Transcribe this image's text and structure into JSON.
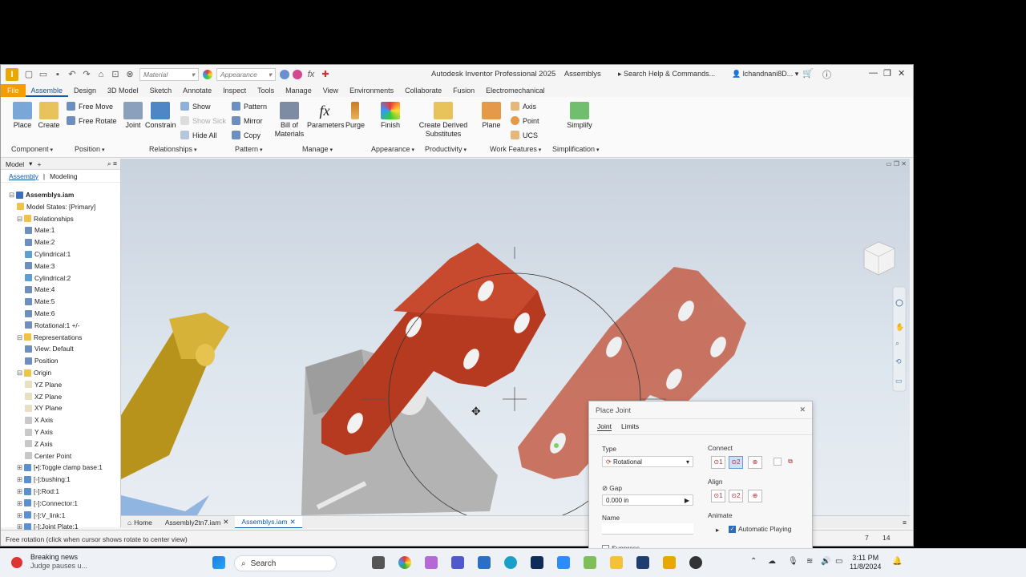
{
  "title_bar": {
    "app_title": "Autodesk Inventor Professional 2025",
    "project": "Assemblys",
    "material_placeholder": "Material",
    "appearance_placeholder": "Appearance",
    "search_placeholder": "Search Help & Commands...",
    "user": "lchandnani8D..."
  },
  "tabs": [
    "File",
    "Assemble",
    "Design",
    "3D Model",
    "Sketch",
    "Annotate",
    "Inspect",
    "Tools",
    "Manage",
    "View",
    "Environments",
    "Collaborate",
    "Fusion",
    "Electromechanical"
  ],
  "active_tab": "Assemble",
  "ribbon": {
    "place": "Place",
    "create": "Create",
    "free_move": "Free Move",
    "free_rotate": "Free Rotate",
    "joint": "Joint",
    "constrain": "Constrain",
    "show": "Show",
    "show_sick": "Show Sick",
    "hide_all": "Hide All",
    "pattern": "Pattern",
    "mirror": "Mirror",
    "copy": "Copy",
    "bill_of_materials_1": "Bill of",
    "bill_of_materials_2": "Materials",
    "parameters": "Parameters",
    "purge": "Purge",
    "finish": "Finish",
    "create_derived_1": "Create Derived",
    "create_derived_2": "Substitutes",
    "plane": "Plane",
    "axis": "Axis",
    "point": "Point",
    "ucs": "UCS",
    "simplify": "Simplify",
    "groups": {
      "component": "Component",
      "position": "Position",
      "relationships": "Relationships",
      "pattern": "Pattern",
      "manage": "Manage",
      "appearance": "Appearance",
      "productivity": "Productivity",
      "work_features": "Work Features",
      "simplification": "Simplification"
    }
  },
  "browser": {
    "header": "Model",
    "tab_assembly": "Assembly",
    "tab_modeling": "Modeling",
    "items": [
      {
        "label": "Assemblys.iam",
        "depth": 0
      },
      {
        "label": "Model States: [Primary]",
        "depth": 1
      },
      {
        "label": "Relationships",
        "depth": 1
      },
      {
        "label": "Mate:1",
        "depth": 2
      },
      {
        "label": "Mate:2",
        "depth": 2
      },
      {
        "label": "Cylindrical:1",
        "depth": 2
      },
      {
        "label": "Mate:3",
        "depth": 2
      },
      {
        "label": "Cylindrical:2",
        "depth": 2
      },
      {
        "label": "Mate:4",
        "depth": 2
      },
      {
        "label": "Mate:5",
        "depth": 2
      },
      {
        "label": "Mate:6",
        "depth": 2
      },
      {
        "label": "Rotational:1 +/-",
        "depth": 2
      },
      {
        "label": "Representations",
        "depth": 1
      },
      {
        "label": "View: Default",
        "depth": 2
      },
      {
        "label": "Position",
        "depth": 2
      },
      {
        "label": "Origin",
        "depth": 1
      },
      {
        "label": "YZ Plane",
        "depth": 2
      },
      {
        "label": "XZ Plane",
        "depth": 2
      },
      {
        "label": "XY Plane",
        "depth": 2
      },
      {
        "label": "X Axis",
        "depth": 2
      },
      {
        "label": "Y Axis",
        "depth": 2
      },
      {
        "label": "Z Axis",
        "depth": 2
      },
      {
        "label": "Center Point",
        "depth": 2
      },
      {
        "label": "[•]:Toggle clamp base:1",
        "depth": 1
      },
      {
        "label": "[◦]:bushing:1",
        "depth": 1
      },
      {
        "label": "[◦]:Rod:1",
        "depth": 1
      },
      {
        "label": "[◦]:Connector:1",
        "depth": 1
      },
      {
        "label": "[◦]:V_link:1",
        "depth": 1
      },
      {
        "label": "[◦]:Joint Plate:1",
        "depth": 1
      }
    ]
  },
  "doc_tabs": {
    "home": "Home",
    "tab1": "Assembly2tn7.iam",
    "tab2": "Assemblys.iam"
  },
  "status": {
    "message": "Free rotation (click when cursor shows rotate to center view)",
    "num1": "7",
    "num2": "14"
  },
  "dialog": {
    "title": "Place Joint",
    "tab_joint": "Joint",
    "tab_limits": "Limits",
    "type_label": "Type",
    "type_value": "Rotational",
    "connect_label": "Connect",
    "align_label": "Align",
    "gap_label": "Gap",
    "gap_value": "0.000 in",
    "name_label": "Name",
    "animate_label": "Animate",
    "automatic_playing": "Automatic Playing",
    "suppress": "Suppress"
  },
  "taskbar": {
    "news_title": "Breaking news",
    "news_sub": "Judge pauses u...",
    "search": "Search",
    "time": "3:11 PM",
    "date": "11/8/2024"
  },
  "colors": {
    "accent": "#0a5aa8",
    "file_tab": "#f59c00",
    "part_red": "#c24a2e",
    "part_gold": "#c9a01e",
    "part_grey": "#a8a8a8"
  }
}
